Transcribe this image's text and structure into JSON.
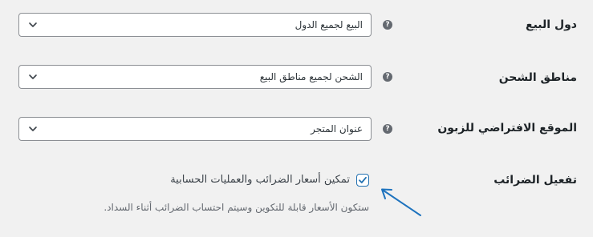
{
  "settings": {
    "selling_locations": {
      "label": "دول البيع",
      "help_icon": "?",
      "value": "البيع لجميع الدول",
      "icon": "chevron-down-icon"
    },
    "shipping_locations": {
      "label": "مناطق الشحن",
      "help_icon": "?",
      "value": "الشحن لجميع مناطق البيع",
      "icon": "chevron-down-icon"
    },
    "default_customer_location": {
      "label": "الموقع الافتراضي للزبون",
      "help_icon": "?",
      "value": "عنوان المتجر",
      "icon": "chevron-down-icon"
    },
    "enable_taxes": {
      "label": "تفعيل الضرائب",
      "checkbox_label": "تمكين أسعار الضرائب والعمليات الحسابية",
      "checked": true,
      "description": "ستكون الأسعار قابلة للتكوين وسيتم احتساب الضرائب أثناء السداد."
    }
  },
  "colors": {
    "accent": "#2271b1",
    "page_background": "#f1f1f1",
    "annotation_arrow": "#1e73be"
  }
}
